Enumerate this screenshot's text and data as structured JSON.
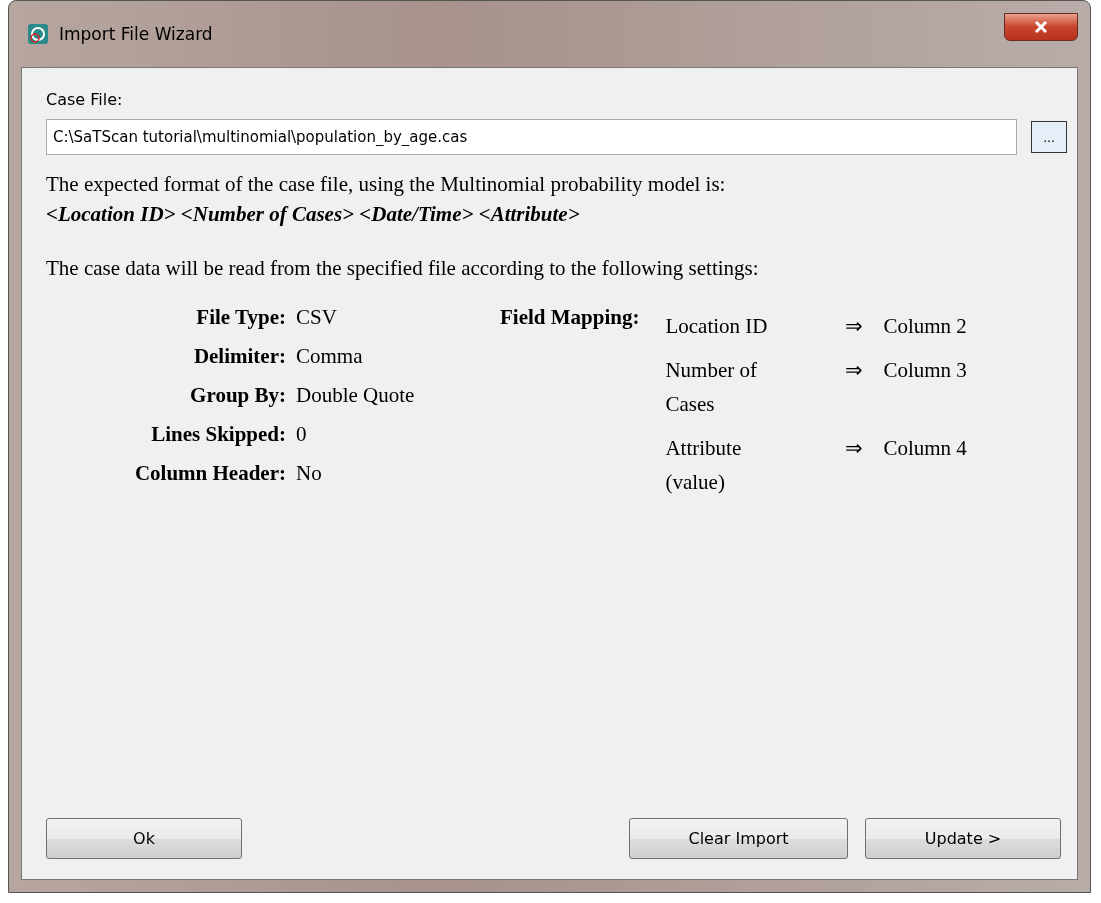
{
  "window": {
    "title": "Import File Wizard"
  },
  "case_file": {
    "label": "Case File:",
    "value": "C:\\SaTScan tutorial\\multinomial\\population_by_age.cas",
    "browse_button": "..."
  },
  "format_intro": "The expected format of the case file, using the Multinomial probability model is:",
  "format_fields": "<Location ID> <Number of Cases> <Date/Time> <Attribute>",
  "settings_intro": "The case data will be read from the specified file according to the following settings:",
  "settings": [
    {
      "label": "File Type:",
      "value": "CSV"
    },
    {
      "label": "Delimiter:",
      "value": "Comma"
    },
    {
      "label": "Group By:",
      "value": "Double Quote"
    },
    {
      "label": "Lines Skipped:",
      "value": "0"
    },
    {
      "label": "Column Header:",
      "value": "No"
    }
  ],
  "field_mapping": {
    "label": "Field Mapping:",
    "rows": [
      {
        "field": "Location ID",
        "arrow": "⇒",
        "column": "Column 2"
      },
      {
        "field": "Number of Cases",
        "arrow": "⇒",
        "column": "Column 3"
      },
      {
        "field": "Attribute (value)",
        "arrow": "⇒",
        "column": "Column 4"
      }
    ]
  },
  "buttons": {
    "left": [
      "Ok"
    ],
    "right": [
      "Clear Import",
      "Update >"
    ]
  }
}
